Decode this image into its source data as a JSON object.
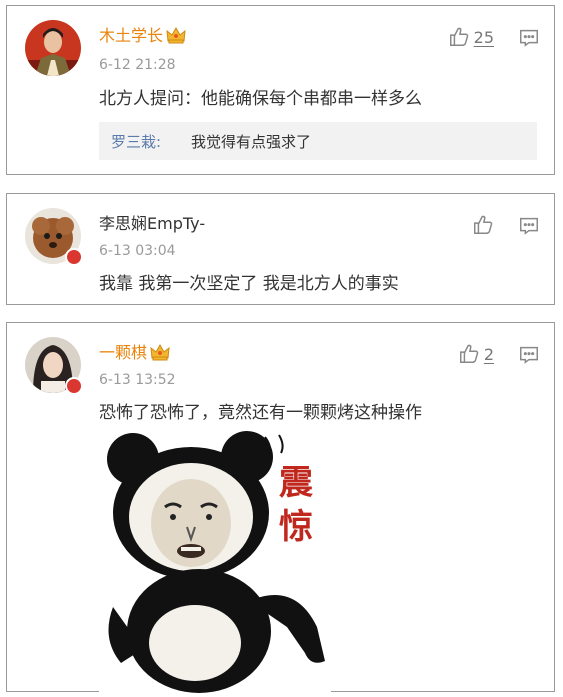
{
  "comments": [
    {
      "username": "木土学长",
      "time": "6-12 21:28",
      "text": "北方人提问：他能确保每个串都串一样多么",
      "likes": "25",
      "reply": {
        "name": "罗三栽:",
        "text": "我觉得有点强求了"
      }
    },
    {
      "username": "李思娴EmpTy-",
      "time": "6-13 03:04",
      "text": "我靠 我第一次坚定了 我是北方人的事实",
      "likes": ""
    },
    {
      "username": "一颗棋",
      "time": "6-13 13:52",
      "text": "恐怖了恐怖了，竟然还有一颗颗烤这种操作",
      "likes": "2",
      "meme_text": [
        "震",
        "惊"
      ]
    }
  ],
  "colors": {
    "vip_name": "#e8840c",
    "reply_name": "#5a7bac",
    "muted": "#9a9a9a",
    "badge": "#d9372f"
  },
  "icons": [
    "thumbs-up-icon",
    "comment-icon",
    "crown-icon",
    "verified-badge-icon"
  ]
}
